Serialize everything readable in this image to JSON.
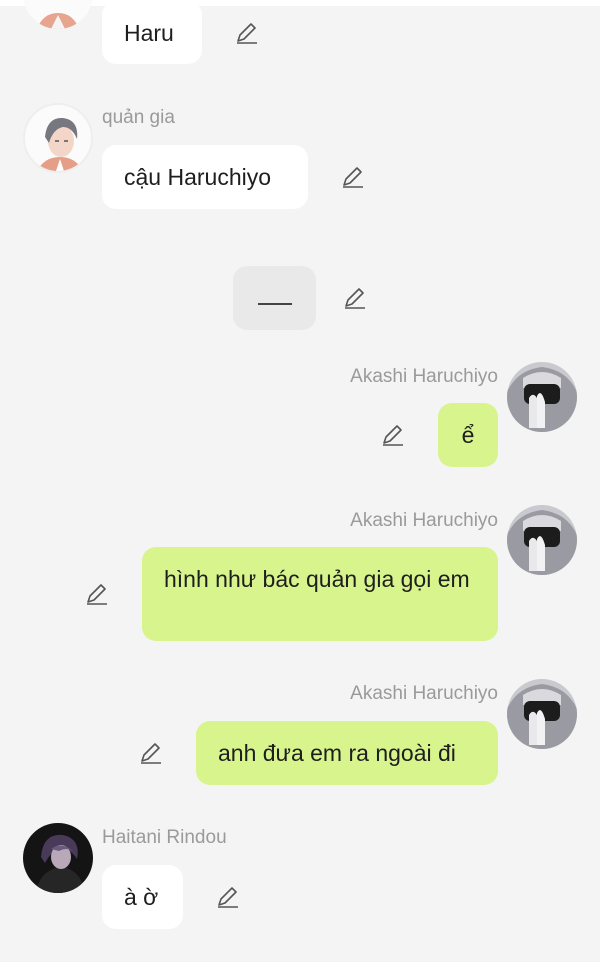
{
  "theme": {
    "background": "#f4f4f4",
    "bubble_other": "#ffffff",
    "bubble_self": "#d8f48c",
    "bubble_narration": "#e9e9e9",
    "name_color": "#9a9a9a",
    "text_color": "#1e1e1e"
  },
  "messages": [
    {
      "sender": "",
      "text": "Haru",
      "side": "left",
      "avatar": "butler-avatar",
      "edit_icon": "pencil-icon"
    },
    {
      "sender": "quản gia",
      "text": "cậu Haruchiyo",
      "side": "left",
      "avatar": "butler-avatar",
      "edit_icon": "pencil-icon"
    },
    {
      "sender": "",
      "text": "",
      "side": "center",
      "type": "narration",
      "edit_icon": "pencil-icon"
    },
    {
      "sender": "Akashi Haruchiyo",
      "text": "ể",
      "side": "right",
      "avatar": "masked-avatar",
      "edit_icon": "pencil-icon"
    },
    {
      "sender": "Akashi Haruchiyo",
      "text": "hình như bác quản gia gọi em",
      "side": "right",
      "avatar": "masked-avatar",
      "edit_icon": "pencil-icon"
    },
    {
      "sender": "Akashi Haruchiyo",
      "text": "anh đưa em ra ngoài đi",
      "side": "right",
      "avatar": "masked-avatar",
      "edit_icon": "pencil-icon"
    },
    {
      "sender": "Haitani Rindou",
      "text": "à ờ",
      "side": "left",
      "avatar": "dark-hair-avatar",
      "edit_icon": "pencil-icon"
    }
  ]
}
